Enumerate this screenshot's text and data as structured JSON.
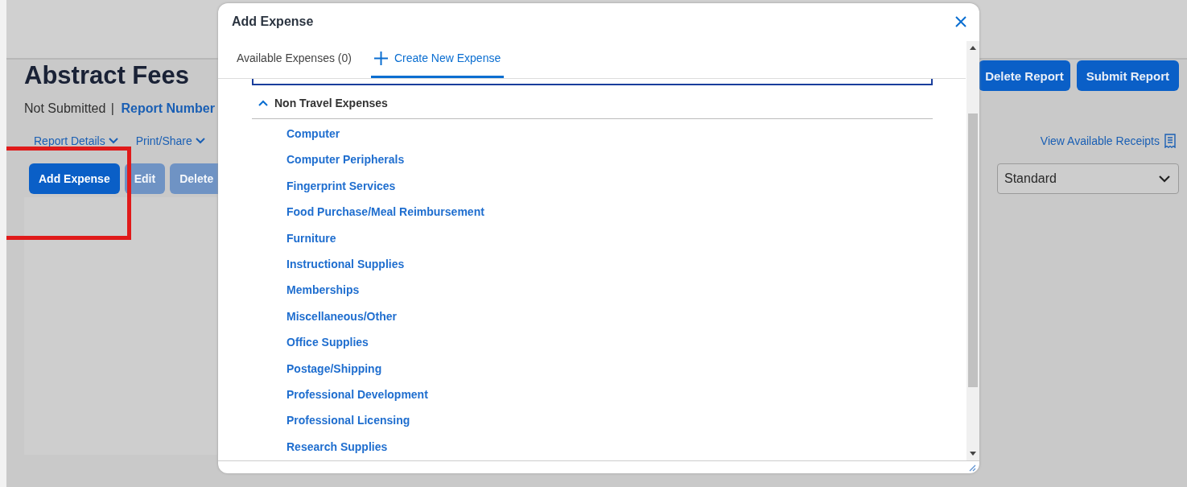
{
  "report": {
    "title": "Abstract Fees",
    "status": "Not Submitted",
    "separator": "|",
    "report_number_link": "Report Number",
    "menus": [
      {
        "label": "Report Details"
      },
      {
        "label": "Print/Share"
      }
    ],
    "actions": [
      {
        "label": "Add Expense",
        "disabled": false
      },
      {
        "label": "Edit",
        "disabled": true
      },
      {
        "label": "Delete",
        "disabled": true
      }
    ],
    "header_buttons": [
      {
        "label": "Delete Report"
      },
      {
        "label": "Submit Report"
      }
    ],
    "receipts_link": "View Available Receipts",
    "view_select": {
      "value": "Standard"
    }
  },
  "highlight": {
    "shown": true
  },
  "dialog": {
    "title": "Add Expense",
    "tabs": [
      {
        "label": "Available Expenses (0)",
        "kind": "plain",
        "selected": false
      },
      {
        "label": "Create New Expense",
        "kind": "add",
        "selected": true
      }
    ],
    "section": {
      "title": "Non Travel Expenses",
      "expanded": true,
      "items": [
        "Computer",
        "Computer Peripherals",
        "Fingerprint Services",
        "Food Purchase/Meal Reimbursement",
        "Furniture",
        "Instructional Supplies",
        "Memberships",
        "Miscellaneous/Other",
        "Office Supplies",
        "Postage/Shipping",
        "Professional Development",
        "Professional Licensing",
        "Research Supplies"
      ]
    }
  }
}
